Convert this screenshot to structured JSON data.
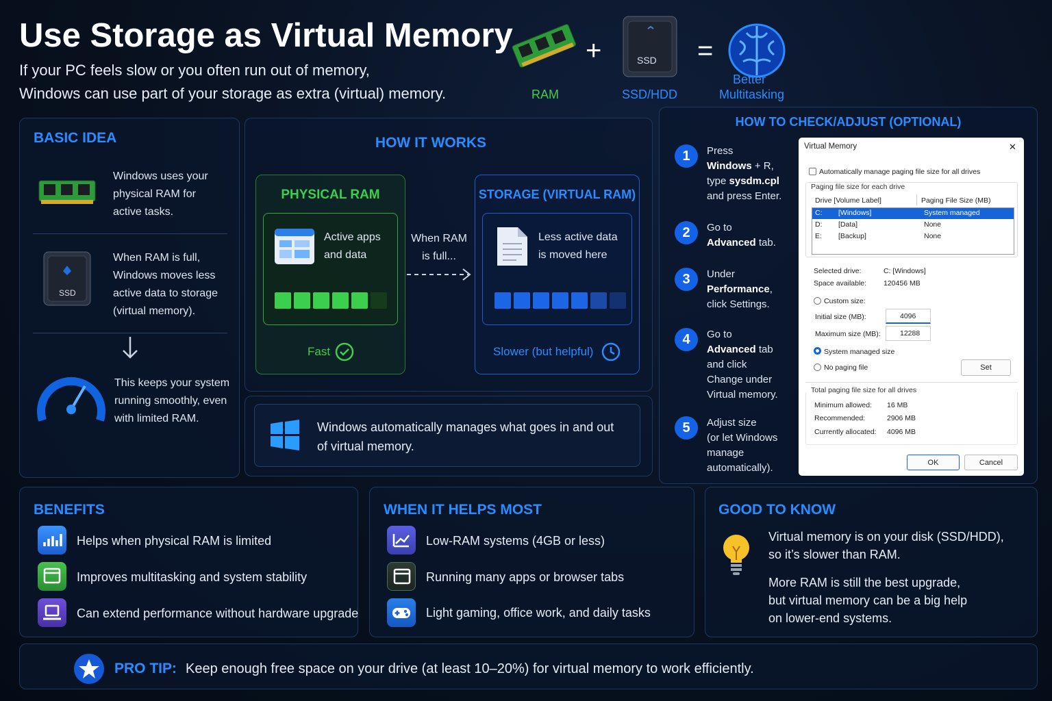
{
  "header": {
    "title": "Use Storage as Virtual Memory",
    "sub1": "If your PC feels slow or you often run out of memory,",
    "sub2": "Windows can use part of your storage as extra (virtual) memory.",
    "ram": "RAM",
    "ssd": "SSD/HDD",
    "better1": "Better",
    "better2": "Multitasking",
    "ssd_chip": "SSD",
    "plus": "+",
    "equals": "="
  },
  "basic": {
    "title": "BASIC IDEA",
    "t1": [
      "Windows uses your",
      "physical RAM for",
      "active tasks."
    ],
    "t2": [
      "When RAM is full,",
      "Windows moves less",
      "active data to storage",
      "(virtual memory)."
    ],
    "t3": [
      "This keeps your system",
      "running smoothly, even",
      "with limited RAM."
    ],
    "ssd_chip": "SSD"
  },
  "how": {
    "title": "HOW IT WORKS",
    "ram_title": "PHYSICAL RAM",
    "ram_text": [
      "Active apps",
      "and data"
    ],
    "ram_speed": "Fast",
    "mid": [
      "When RAM",
      "is full..."
    ],
    "stor_title": "STORAGE (VIRTUAL RAM)",
    "stor_text": [
      "Less active data",
      "is moved here"
    ],
    "stor_speed": "Slower (but helpful)",
    "ram_fill": "5 of 6",
    "stor_fill": "6 of 7",
    "note": [
      "Windows automatically manages what goes in and out",
      "of virtual memory."
    ]
  },
  "check": {
    "title": "HOW TO CHECK/ADJUST (OPTIONAL)",
    "steps": [
      {
        "n": "1",
        "lines": [
          "Press",
          "<b>Windows</b> + R,",
          "type <b>sysdm.cpl</b>",
          "and press Enter."
        ]
      },
      {
        "n": "2",
        "lines": [
          "Go to",
          "<b>Advanced</b> tab."
        ]
      },
      {
        "n": "3",
        "lines": [
          "Under",
          "<b>Performance</b>,",
          "click Settings."
        ]
      },
      {
        "n": "4",
        "lines": [
          "Go to",
          "<b>Advanced</b> tab",
          "and click",
          "Change under",
          "Virtual memory."
        ]
      },
      {
        "n": "5",
        "lines": [
          "Adjust size",
          "(or let Windows",
          "manage",
          "automatically)."
        ]
      }
    ]
  },
  "dialog": {
    "title": "Virtual Memory",
    "close": "✕",
    "auto": "Automatically manage paging file size for all drives",
    "group": "Paging file size for each drive",
    "col1": "Drive  [Volume Label]",
    "col2": "Paging File Size (MB)",
    "rows": [
      {
        "d": "C:",
        "l": "[Windows]",
        "s": "System managed"
      },
      {
        "d": "D:",
        "l": "[Data]",
        "s": "None"
      },
      {
        "d": "E:",
        "l": "[Backup]",
        "s": "None"
      }
    ],
    "sel_label": "Selected drive:",
    "sel_val": "C:  [Windows]",
    "space_label": "Space available:",
    "space_val": "120456 MB",
    "custom": "Custom size:",
    "init_label": "Initial size (MB):",
    "init_val": "4096",
    "max_label": "Maximum size (MB):",
    "max_val": "12288",
    "sysman": "System managed size",
    "nopage": "No paging file",
    "set": "Set",
    "total": "Total paging file size for all drives",
    "min_label": "Minimum allowed:",
    "min_val": "16 MB",
    "rec_label": "Recommended:",
    "rec_val": "2906 MB",
    "cur_label": "Currently allocated:",
    "cur_val": "4096 MB",
    "ok": "OK",
    "cancel": "Cancel"
  },
  "benefits": {
    "title": "BENEFITS",
    "items": [
      "Helps when physical RAM is limited",
      "Improves multitasking and system stability",
      "Can extend performance without hardware upgrade"
    ]
  },
  "helps": {
    "title": "WHEN IT HELPS MOST",
    "items": [
      "Low-RAM systems (4GB or less)",
      "Running many apps or browser tabs",
      "Light gaming, office work, and daily tasks"
    ]
  },
  "good": {
    "title": "GOOD TO KNOW",
    "p1": [
      "Virtual memory is on your disk (SSD/HDD),",
      "so it’s slower than RAM."
    ],
    "p2": [
      "More RAM is still the best upgrade,",
      "but virtual memory can be a big help",
      "on lower-end systems."
    ]
  },
  "tip": {
    "label": "PRO TIP:",
    "text": "Keep enough free space on your drive (at least 10–20%) for virtual memory to work efficiently."
  },
  "colors": {
    "accent": "#2b8cff",
    "green": "#3ccf4e",
    "panel_border": "#1d3763"
  }
}
